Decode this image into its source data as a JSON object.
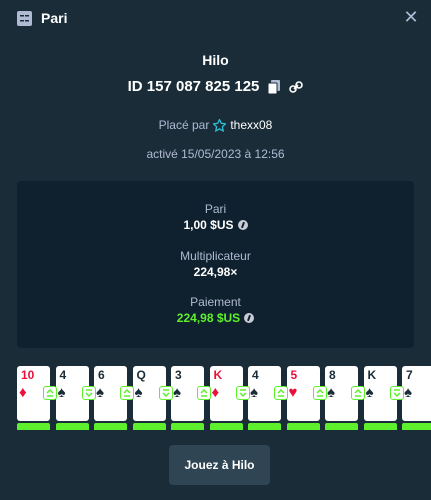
{
  "header": {
    "title": "Pari",
    "close_icon": "close-icon",
    "bet_icon": "bet-slip-icon"
  },
  "game": {
    "name": "Hilo",
    "bet_id": "ID 157 087 825 125"
  },
  "placed": {
    "prefix": "Placé par",
    "username": "thexx08"
  },
  "activated": "activé 15/05/2023 à 12:56",
  "stats": {
    "bet_label": "Pari",
    "bet_value": "1,00 $US",
    "multiplier_label": "Multiplicateur",
    "multiplier_value": "224,98×",
    "payout_label": "Paiement",
    "payout_value": "224,98 $US"
  },
  "cards": [
    {
      "rank": "10",
      "suit": "♦",
      "color": "red"
    },
    {
      "rank": "4",
      "suit": "♠",
      "color": "black"
    },
    {
      "rank": "6",
      "suit": "♠",
      "color": "black"
    },
    {
      "rank": "Q",
      "suit": "♠",
      "color": "black"
    },
    {
      "rank": "3",
      "suit": "♠",
      "color": "black"
    },
    {
      "rank": "K",
      "suit": "♦",
      "color": "red"
    },
    {
      "rank": "4",
      "suit": "♠",
      "color": "black"
    },
    {
      "rank": "5",
      "suit": "♥",
      "color": "red"
    },
    {
      "rank": "8",
      "suit": "♠",
      "color": "black"
    },
    {
      "rank": "K",
      "suit": "♠",
      "color": "black"
    },
    {
      "rank": "7",
      "suit": "♠",
      "color": "black"
    }
  ],
  "choices": [
    "higher-equal",
    "lower-equal",
    "higher-equal",
    "lower-equal",
    "higher-equal",
    "lower-equal",
    "higher-equal",
    "higher-equal",
    "higher-equal",
    "lower-equal"
  ],
  "play_button": "Jouez à Hilo",
  "colors": {
    "background": "#1a2c38",
    "panel": "#0f212e",
    "win_green": "#5ef02d",
    "card_red": "#e9113c"
  }
}
